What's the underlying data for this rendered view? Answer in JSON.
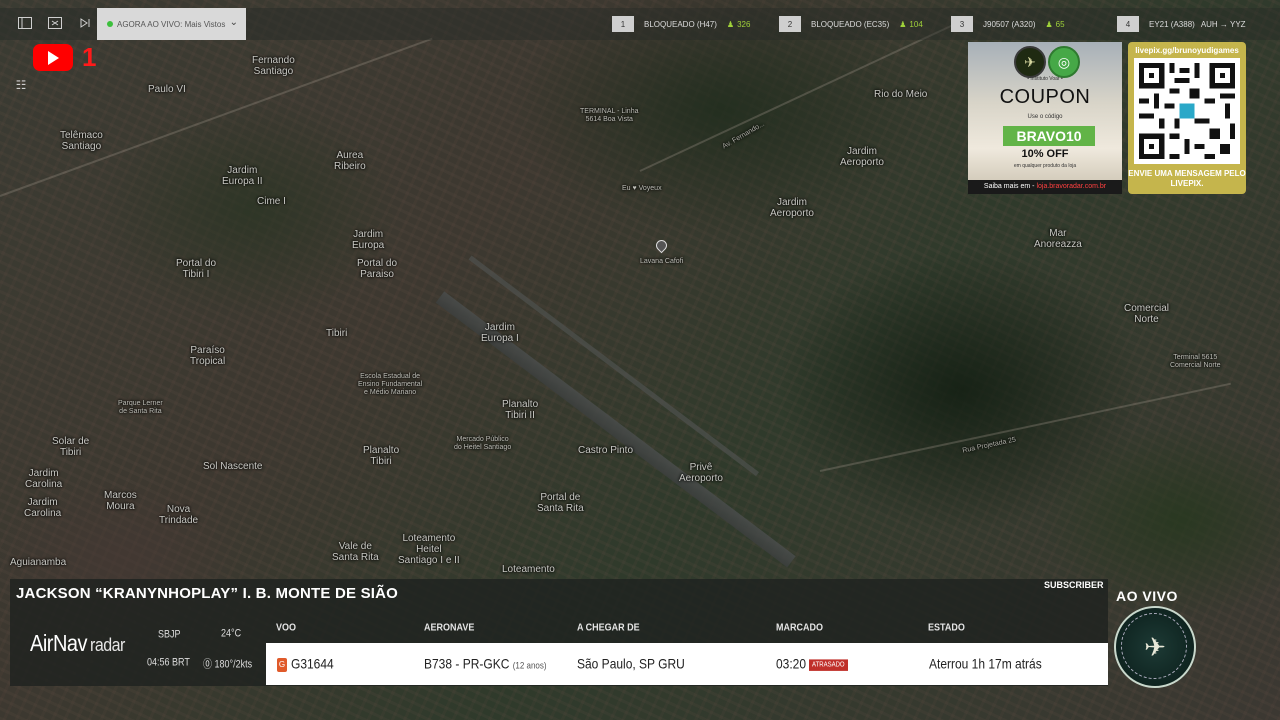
{
  "topbar": {
    "live_dropdown_label": "AGORA AO VIVO: Mais Vistos",
    "ticker": [
      {
        "rank": "1",
        "label": "BLOQUEADO (H47)",
        "count": "326"
      },
      {
        "rank": "2",
        "label": "BLOQUEADO (EC35)",
        "count": "104"
      },
      {
        "rank": "3",
        "label": "J90507 (A320)",
        "count": "65"
      },
      {
        "rank": "4",
        "label": "EY21 (A388)",
        "route": "AUH → YYZ"
      }
    ]
  },
  "youtube": {
    "notification_count": "1"
  },
  "coupon": {
    "brand": "• Instituto Voar •",
    "title": "COUPON",
    "use_text": "Use o código",
    "code": "BRAVO10",
    "discount": "10% OFF",
    "fine_print": "em qualquer produto da loja",
    "footer_prefix": "Saiba mais em - ",
    "footer_link": "loja.bravoradar.com.br"
  },
  "qr": {
    "url": "livepix.gg/brunoyudigames",
    "message": "ENVIE UMA MENSAGEM PELO LIVEPIX."
  },
  "map": {
    "labels": [
      {
        "text": "Fernando\nSantiago"
      },
      {
        "text": "Paulo VI"
      },
      {
        "text": "Telêmaco\nSantiago"
      },
      {
        "text": "Aurea\nRibeiro"
      },
      {
        "text": "Jardim\nEuropa II"
      },
      {
        "text": "Cime I"
      },
      {
        "text": "Jardim\nEuropa"
      },
      {
        "text": "Portal do\nTibiri I"
      },
      {
        "text": "Portal do\nParaiso"
      },
      {
        "text": "Tibiri"
      },
      {
        "text": "Paraíso\nTropical"
      },
      {
        "text": "Jardim\nEuropa I"
      },
      {
        "text": "Planalto\nTibiri II"
      },
      {
        "text": "Planalto\nTibiri"
      },
      {
        "text": "Castro Pinto"
      },
      {
        "text": "Solar de\nTibiri"
      },
      {
        "text": "Jardim\nCarolina"
      },
      {
        "text": "Jardim\nCarolina"
      },
      {
        "text": "Marcos\nMoura"
      },
      {
        "text": "Sol Nascente"
      },
      {
        "text": "Nova\nTrindade"
      },
      {
        "text": "Vale de\nSanta Rita"
      },
      {
        "text": "Loteamento\nHeitel\nSantiago I e II"
      },
      {
        "text": "Portal de\nSanta Rita"
      },
      {
        "text": "Privê\nAeroporto"
      },
      {
        "text": "Jardim\nAeroporto"
      },
      {
        "text": "Jardim\nAeroporto"
      },
      {
        "text": "Rio do Meio"
      },
      {
        "text": "Mar\nAnoreazza"
      },
      {
        "text": "Comercial\nNorte"
      },
      {
        "text": "Aguianamba"
      },
      {
        "text": "Loteamento"
      }
    ],
    "small_labels": [
      {
        "text": "TERMINAL - Linha\n5614 Boa Vista"
      },
      {
        "text": "Eu ♥ Voyeux"
      },
      {
        "text": "Lavana Cafofi"
      },
      {
        "text": "Parque Lerner\nde Santa Rita"
      },
      {
        "text": "Escola Estadual de\nEnsino Fundamental\ne Médio Mariano"
      },
      {
        "text": "Mercado Público\ndo Heitel Santiago"
      },
      {
        "text": "Terminal 5615\nComercial Norte"
      }
    ],
    "road_labels": [
      {
        "text": "Rua Projetada 25"
      },
      {
        "text": "Av. Fernando..."
      }
    ]
  },
  "panel": {
    "streamer_name": "JACKSON “KRANYNHOPLAY” I. B. MONTE DE SIÃO",
    "subscriber_badge": "SUBSCRIBER",
    "logo_main": "AirNav",
    "logo_sub": "radar",
    "airport_code": "SBJP",
    "temperature": "24°C",
    "local_time": "04:56 BRT",
    "wind": "180°/2kts",
    "columns": {
      "flight": "VOO",
      "aircraft": "AERONAVE",
      "from": "A CHEGAR DE",
      "scheduled": "MARCADO",
      "status": "ESTADO"
    },
    "row": {
      "airline_icon": "G",
      "flight": "G31644",
      "aircraft": "B738 - PR-GKC",
      "aircraft_age": "(12 anos)",
      "from": "São Paulo, SP GRU",
      "scheduled": "03:20",
      "delay_badge": "ATRASADO",
      "status": "Aterrou 1h 17m atrás"
    }
  },
  "ao_vivo": "AO VIVO",
  "team_badge_text": "BRAVO RADAR"
}
